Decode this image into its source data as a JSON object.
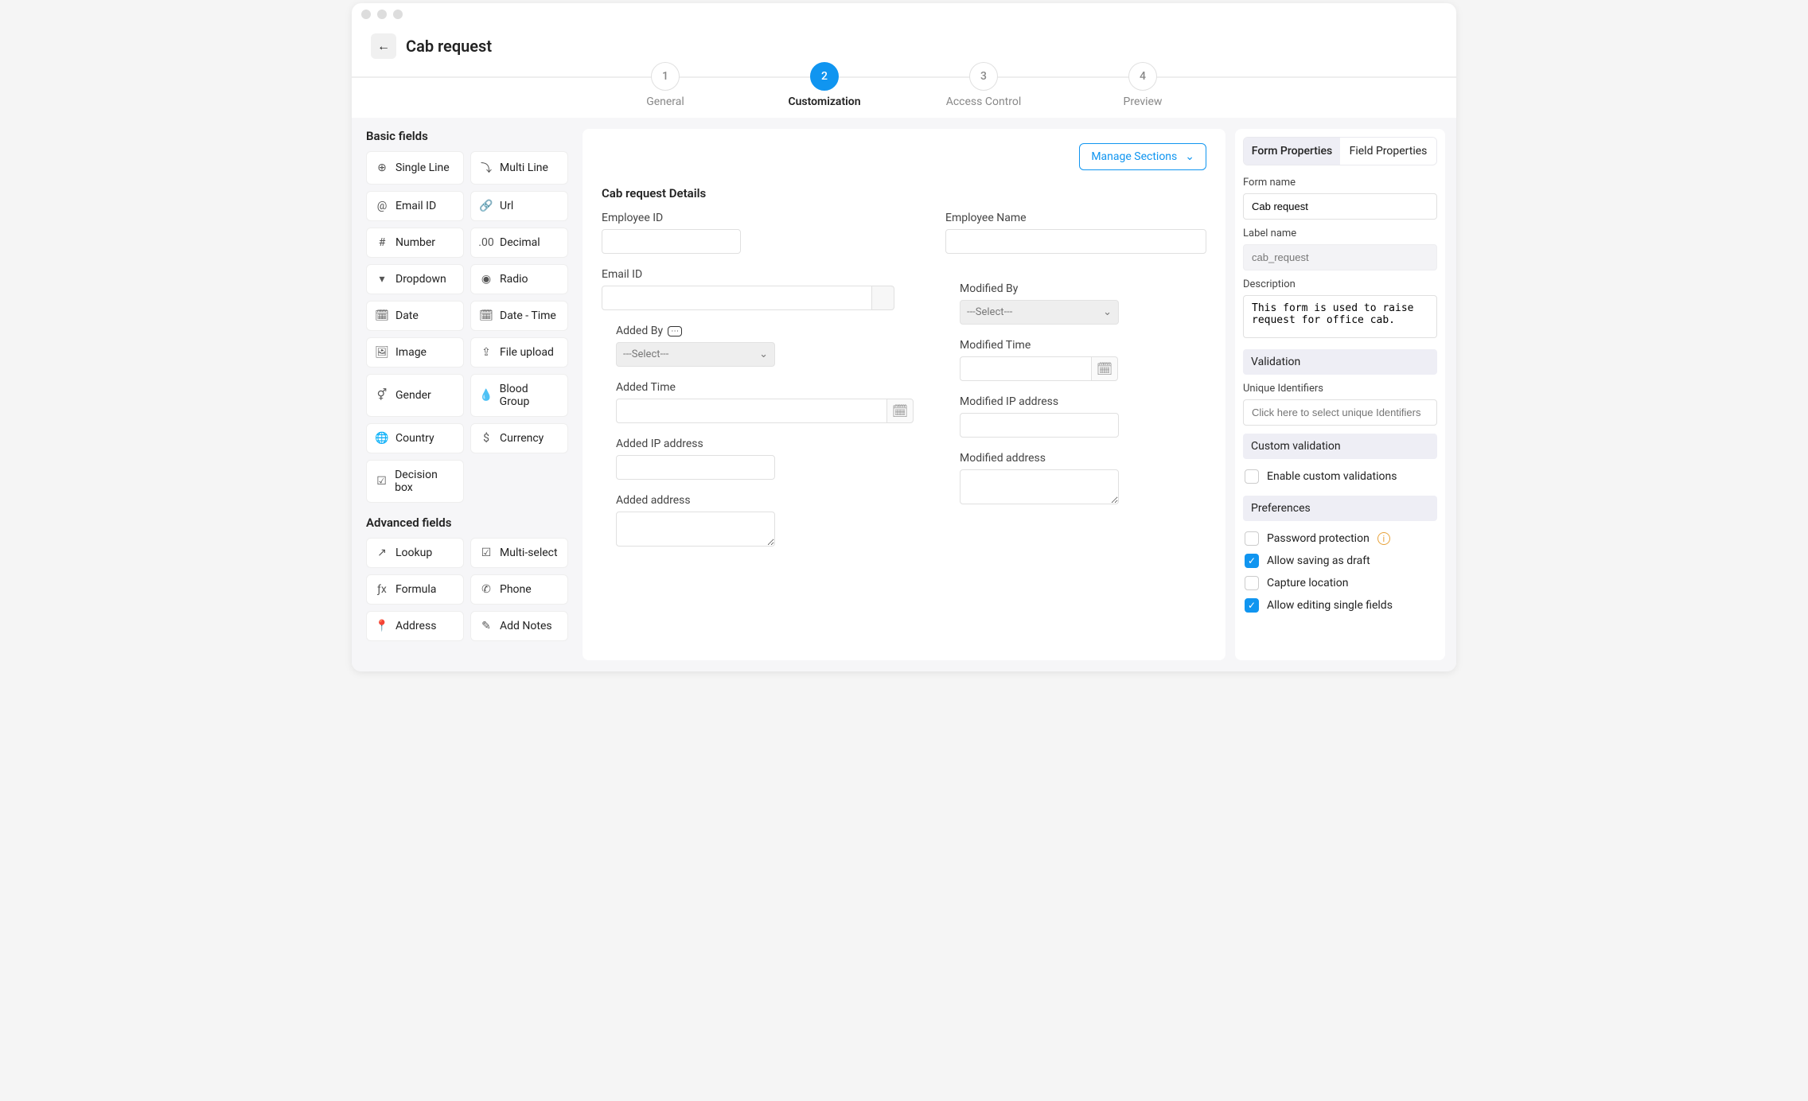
{
  "page": {
    "title": "Cab request"
  },
  "stepper": [
    {
      "num": "1",
      "label": "General"
    },
    {
      "num": "2",
      "label": "Customization"
    },
    {
      "num": "3",
      "label": "Access Control"
    },
    {
      "num": "4",
      "label": "Preview"
    }
  ],
  "activeStep": 1,
  "left": {
    "basic_title": "Basic fields",
    "basic": [
      {
        "icon": "⊕",
        "label": "Single Line"
      },
      {
        "icon": "⤵",
        "label": "Multi Line"
      },
      {
        "icon": "@",
        "label": "Email ID"
      },
      {
        "icon": "🔗",
        "label": "Url"
      },
      {
        "icon": "#",
        "label": "Number"
      },
      {
        "icon": ".00",
        "label": "Decimal"
      },
      {
        "icon": "▾",
        "label": "Dropdown"
      },
      {
        "icon": "◉",
        "label": "Radio"
      },
      {
        "icon": "🗓",
        "label": "Date"
      },
      {
        "icon": "🗓",
        "label": "Date - Time"
      },
      {
        "icon": "🖼",
        "label": "Image"
      },
      {
        "icon": "⇪",
        "label": "File upload"
      },
      {
        "icon": "⚥",
        "label": "Gender"
      },
      {
        "icon": "💧",
        "label": "Blood Group"
      },
      {
        "icon": "🌐",
        "label": "Country"
      },
      {
        "icon": "$",
        "label": "Currency"
      },
      {
        "icon": "☑",
        "label": "Decision box"
      }
    ],
    "advanced_title": "Advanced fields",
    "advanced": [
      {
        "icon": "↗",
        "label": "Lookup"
      },
      {
        "icon": "☑",
        "label": "Multi-select"
      },
      {
        "icon": "ƒx",
        "label": "Formula"
      },
      {
        "icon": "✆",
        "label": "Phone"
      },
      {
        "icon": "📍",
        "label": "Address"
      },
      {
        "icon": "✎",
        "label": "Add Notes"
      }
    ]
  },
  "center": {
    "manage_label": "Manage Sections",
    "section_title": "Cab request Details",
    "select_placeholder": "---Select---",
    "fields": {
      "employee_id": "Employee ID",
      "employee_name": "Employee Name",
      "email_id": "Email ID",
      "added_by": "Added By",
      "modified_by": "Modified By",
      "added_time": "Added Time",
      "modified_time": "Modified Time",
      "added_ip": "Added IP address",
      "modified_ip": "Modified IP address",
      "added_address": "Added address",
      "modified_address": "Modified address"
    }
  },
  "right": {
    "tabs": {
      "form": "Form Properties",
      "field": "Field Properties"
    },
    "form_name_label": "Form name",
    "form_name": "Cab request",
    "label_name_label": "Label name",
    "label_name": "cab_request",
    "description_label": "Description",
    "description": "This form is used to raise request for office cab.",
    "validation": "Validation",
    "unique_label": "Unique Identifiers",
    "unique_placeholder": "Click here to select unique Identifiers",
    "custom_validation": "Custom validation",
    "enable_custom": "Enable custom validations",
    "preferences": "Preferences",
    "prefs": [
      {
        "label": "Password protection",
        "checked": false,
        "info": true
      },
      {
        "label": "Allow saving as draft",
        "checked": true
      },
      {
        "label": "Capture location",
        "checked": false
      },
      {
        "label": "Allow editing single fields",
        "checked": true
      }
    ]
  }
}
